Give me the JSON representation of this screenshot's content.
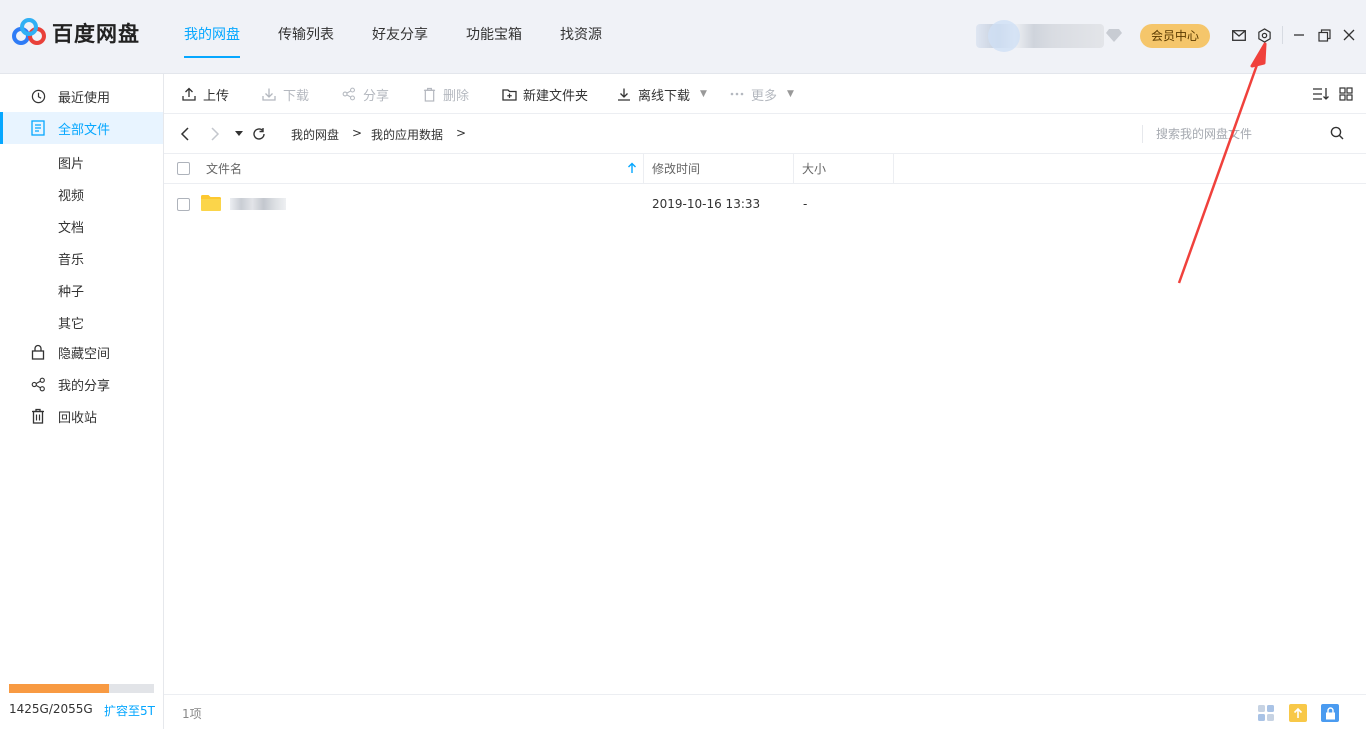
{
  "app": {
    "name": "百度网盘",
    "brand_color": "#06a7ff"
  },
  "nav": {
    "tabs": [
      {
        "label": "我的网盘",
        "active": true
      },
      {
        "label": "传输列表"
      },
      {
        "label": "好友分享"
      },
      {
        "label": "功能宝箱"
      },
      {
        "label": "找资源"
      }
    ]
  },
  "header": {
    "vip_label": "会员中心"
  },
  "sidebar": {
    "items": [
      {
        "label": "最近使用",
        "icon": "clock-icon"
      },
      {
        "label": "全部文件",
        "icon": "file-icon",
        "active": true
      },
      {
        "label": "隐藏空间",
        "icon": "lock-icon"
      },
      {
        "label": "我的分享",
        "icon": "share-icon"
      },
      {
        "label": "回收站",
        "icon": "trash-icon"
      }
    ],
    "sub_items": [
      "图片",
      "视频",
      "文档",
      "音乐",
      "种子",
      "其它"
    ],
    "storage": {
      "used_text": "1425G/2055G",
      "used_fraction": 0.693,
      "expand_label": "扩容至5T"
    }
  },
  "toolbar": {
    "upload": "上传",
    "download": "下载",
    "share": "分享",
    "delete": "删除",
    "new_folder": "新建文件夹",
    "offline_download": "离线下载",
    "more": "更多"
  },
  "address": {
    "breadcrumbs": [
      "我的网盘",
      "我的应用数据"
    ],
    "separator": ">",
    "search_placeholder": "搜索我的网盘文件"
  },
  "table": {
    "headers": {
      "name": "文件名",
      "modified": "修改时间",
      "size": "大小"
    },
    "rows": [
      {
        "name": "",
        "modified": "2019-10-16 13:33",
        "size": "-",
        "type": "folder"
      }
    ]
  },
  "footer": {
    "count": "1项"
  },
  "annotation": {
    "color": "#f0413c"
  }
}
